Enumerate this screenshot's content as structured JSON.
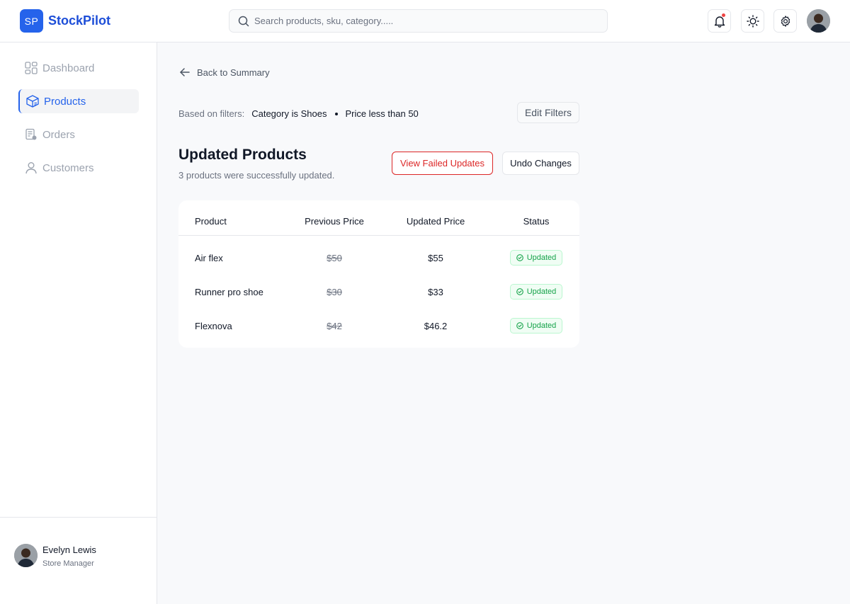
{
  "header": {
    "logo_initials": "SP",
    "app_name": "StockPilot",
    "search_placeholder": "Search products, sku, category.....",
    "brand_color": "#2563eb",
    "notification_dot_color": "#ef4444"
  },
  "sidebar": {
    "items": [
      {
        "label": "Dashboard",
        "icon": "dashboard-icon",
        "active": false
      },
      {
        "label": "Products",
        "icon": "box-icon",
        "active": true
      },
      {
        "label": "Orders",
        "icon": "orders-icon",
        "active": false
      },
      {
        "label": "Customers",
        "icon": "user-icon",
        "active": false
      }
    ],
    "user": {
      "name": "Evelyn Lewis",
      "role": "Store Manager"
    }
  },
  "main": {
    "back_label": "Back to Summary",
    "filters_label": "Based on filters:",
    "filters": [
      "Category is Shoes",
      "Price less than 50"
    ],
    "edit_filters_label": "Edit Filters",
    "title": "Updated Products",
    "subtitle": "3 products were successfully updated.",
    "view_failed_label": "View Failed Updates",
    "undo_label": "Undo Changes",
    "table": {
      "columns": [
        "Product",
        "Previous Price",
        "Updated Price",
        "Status"
      ],
      "rows": [
        {
          "product": "Air flex",
          "previous": "$50",
          "updated": "$55",
          "status": "Updated"
        },
        {
          "product": "Runner pro shoe",
          "previous": "$30",
          "updated": "$33",
          "status": "Updated"
        },
        {
          "product": "Flexnova",
          "previous": "$42",
          "updated": "$46.2",
          "status": "Updated"
        }
      ]
    },
    "status_color": "#16a34a",
    "danger_color": "#dc2626"
  }
}
